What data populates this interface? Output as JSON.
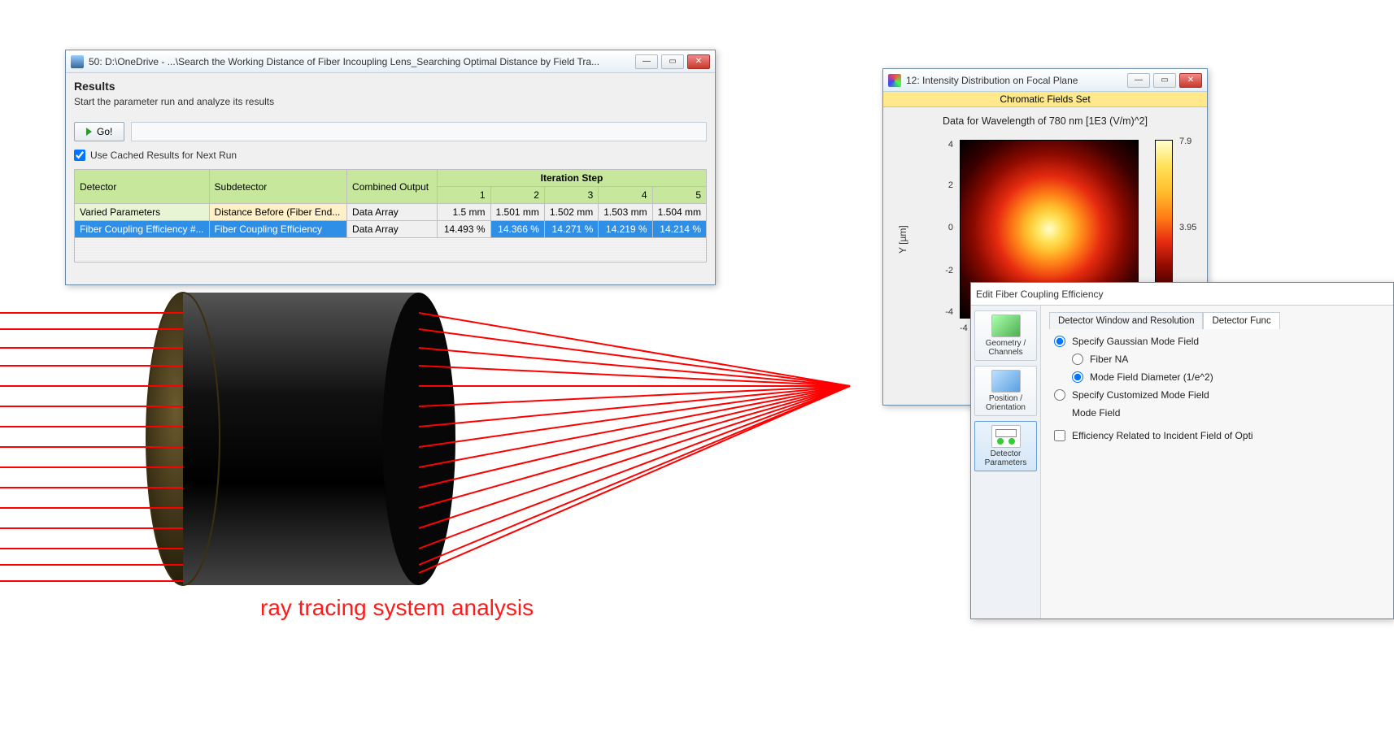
{
  "win50": {
    "title": "50: D:\\OneDrive - ...\\Search the Working Distance of Fiber Incoupling Lens_Searching Optimal Distance by Field Tra...",
    "results_header": "Results",
    "results_sub": "Start the parameter run and analyze its results",
    "go_label": "Go!",
    "cached_label": "Use Cached Results for Next Run",
    "cached_checked": true,
    "columns": {
      "detector": "Detector",
      "subdetector": "Subdetector",
      "combined": "Combined Output",
      "iterhead": "Iteration Step",
      "steps": [
        "1",
        "2",
        "3",
        "4",
        "5"
      ]
    },
    "rows": [
      {
        "detector": "Varied Parameters",
        "sub": "Distance Before (Fiber End...",
        "combined": "Data Array",
        "vals": [
          "1.5 mm",
          "1.501 mm",
          "1.502 mm",
          "1.503 mm",
          "1.504 mm"
        ],
        "selected": false
      },
      {
        "detector": "Fiber Coupling Efficiency #...",
        "sub": "Fiber Coupling Efficiency",
        "combined": "Data Array",
        "vals": [
          "14.493 %",
          "14.366 %",
          "14.271 %",
          "14.219 %",
          "14.214 %"
        ],
        "selected": true
      }
    ]
  },
  "win12": {
    "title": "12: Intensity Distribution on Focal Plane",
    "banner": "Chromatic Fields Set",
    "plot_title": "Data for Wavelength of 780 nm  [1E3 (V/m)^2]",
    "ylabel": "Y [µm]",
    "yticks": [
      "4",
      "2",
      "0",
      "-2",
      "-4"
    ],
    "xticks": [
      "-4"
    ],
    "cb_max": "7.9",
    "cb_mid": "3.95"
  },
  "winFC": {
    "title": "Edit Fiber Coupling Efficiency",
    "side": [
      {
        "name": "geometry-channels",
        "label": "Geometry / Channels"
      },
      {
        "name": "position-orientation",
        "label": "Position / Orientation"
      },
      {
        "name": "detector-parameters",
        "label": "Detector Parameters",
        "selected": true
      }
    ],
    "tabs": [
      {
        "name": "tab-window-res",
        "label": "Detector Window and Resolution"
      },
      {
        "name": "tab-func",
        "label": "Detector Func",
        "active": true
      }
    ],
    "opt_gauss": "Specify Gaussian Mode Field",
    "opt_fiber_na": "Fiber NA",
    "opt_mfd": "Mode Field Diameter (1/e^2)",
    "opt_custom": "Specify Customized Mode Field",
    "lbl_modefield": "Mode Field",
    "chk_eff": "Efficiency Related to Incident Field of Opti"
  },
  "ray_label": "ray tracing system analysis"
}
